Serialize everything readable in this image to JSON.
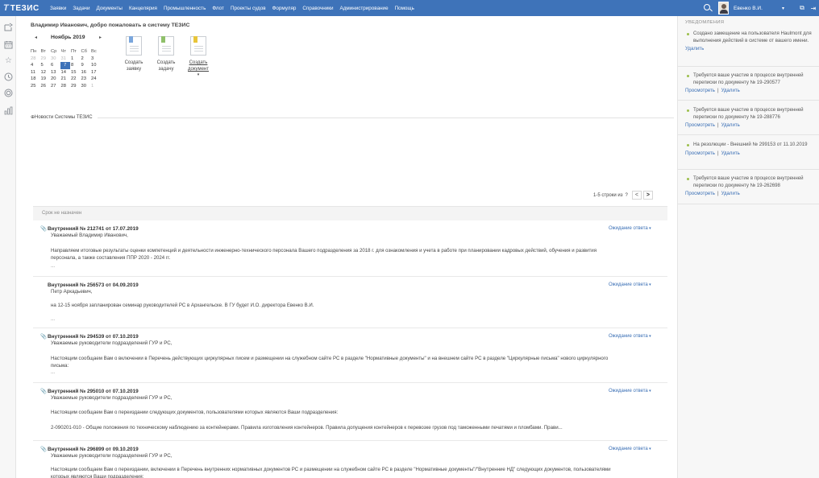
{
  "app": {
    "logo_mark": "Т",
    "logo_text": "ТЕЗИС"
  },
  "menu": [
    "Заявки",
    "Задачи",
    "Документы",
    "Канцелярия",
    "Промышленность",
    "Флот",
    "Проекты судов",
    "Формуляр",
    "Справочники",
    "Администрирование",
    "Помощь"
  ],
  "user": {
    "name": "Евенко В.И.",
    "caret": "▾"
  },
  "topbar_icons": {
    "search": "search-icon",
    "window": "window-icon",
    "exit": "exit-icon"
  },
  "welcome": "Владимир Иванович, добро пожаловать в систему ТЕЗИС",
  "calendar": {
    "prev": "◂",
    "next": "▸",
    "month": "Ноябрь 2019",
    "weekdays": [
      "Пн",
      "Вт",
      "Ср",
      "Чт",
      "Пт",
      "Сб",
      "Вс"
    ],
    "weeks": [
      [
        "28",
        "29",
        "30",
        "31",
        "1",
        "2",
        "3"
      ],
      [
        "4",
        "5",
        "6",
        "7",
        "8",
        "9",
        "10"
      ],
      [
        "11",
        "12",
        "13",
        "14",
        "15",
        "16",
        "17"
      ],
      [
        "18",
        "19",
        "20",
        "21",
        "22",
        "23",
        "24"
      ],
      [
        "25",
        "26",
        "27",
        "28",
        "29",
        "30",
        "1"
      ]
    ],
    "today": "7"
  },
  "actions": {
    "create_request": [
      "Создать",
      "заявку"
    ],
    "create_task": [
      "Создать",
      "задачу"
    ],
    "create_document": [
      "Создать",
      "документ"
    ],
    "dropdown_caret": "▾"
  },
  "news": {
    "title": "⊕Новости Системы ТЕЗИС"
  },
  "pager": {
    "text": "1-5 строки из",
    "total": "?",
    "prev": "<",
    "next": ">"
  },
  "group_label": "Срок не назначен",
  "items": [
    {
      "title": "Внутренний № 212741 от 17.07.2019",
      "greeting": "Уважаемый Владимир Иванович,",
      "body": "Направляем итоговые результаты оценки компетенций и деятельности инженерно-технического персонала Вашего подразделения за 2018 г. для ознакомления и учета в работе при планировании кадровых действий, обучения и развития персонала, а также составления ППР 2020 - 2024 гг.",
      "ellipsis": "...",
      "status": "Ожидание ответа"
    },
    {
      "title": "Внутренний № 256573 от 04.09.2019",
      "greeting": "Петр Аркадьевич,",
      "body": "на 12-15 ноября запланирован семинар руководителей РС в Архангельске. В ГУ будет И.О. директора Евенко В.И.",
      "ellipsis": "...",
      "status": "Ожидание ответа"
    },
    {
      "title": "Внутренний № 294539 от 07.10.2019",
      "greeting": "Уважаемые руководители подразделений ГУР и РС,",
      "body": "Настоящим сообщаем Вам о включении в Перечень действующих циркулярных писем и размещении на служебном сайте РС в разделе \"Нормативные документы\" и на внешнем сайте РС в разделе \"Циркулярные письма\" нового циркулярного письма:",
      "ellipsis": "...",
      "status": "Ожидание ответа"
    },
    {
      "title": "Внутренний № 295010 от 07.10.2019",
      "greeting": "Уважаемые руководители подразделений ГУР и РС,",
      "body": "Настоящим сообщаем Вам о переиздании следующих документов, пользователями которых являются Ваши подразделения:",
      "body2": "2-090201-010 - Общие положения по техническому наблюдению за контейнерами. Правила изготовления контейнеров. Правила допущения контейнеров к перевозке грузов под таможенными печатями и пломбами. Прави...",
      "status": "Ожидание ответа"
    },
    {
      "title": "Внутренний № 296899 от 09.10.2019",
      "greeting": "Уважаемые руководители подразделений ГУР и РС,",
      "body": "Настоящим сообщаем Вам о переиздании, включении в Перечень внутренних нормативных документов РС и размещении на служебном сайте РС в разделе \"Нормативные документы\"/\"Внутренние НД\" следующих документов, пользователями которых являются Ваши подразделения:",
      "status": "Ожидание ответа"
    }
  ],
  "notifications": {
    "title": "УВЕДОМЛЕНИЯ",
    "items": [
      {
        "text": "Создано замещение на пользователя Haulmont для выполнения действий в системе от вашего имени.",
        "view": "",
        "delete": "Удалить"
      },
      {
        "text": "Требуется ваше участие в процессе внутренней переписки по документу № 19-290577",
        "view": "Просмотреть",
        "delete": "Удалить"
      },
      {
        "text": "Требуется ваше участие в процессе внутренней переписки по документу № 19-288776",
        "view": "Просмотреть",
        "delete": "Удалить"
      },
      {
        "text": "На резолюции - Внешний № 299153 от 11.10.2019",
        "view": "Просмотреть",
        "delete": "Удалить"
      },
      {
        "text": "Требуется ваше участие в процессе внутренней переписки по документу № 19-262698",
        "view": "Просмотреть",
        "delete": "Удалить"
      }
    ],
    "separator": "|"
  },
  "colors": {
    "topbar": "#3e73b9",
    "link": "#3a6fb5",
    "today": "#3e73b9",
    "bullet": "#9bbf4a"
  },
  "left_rail_icons": [
    "inbox-arrow-icon",
    "calendar-icon",
    "star-icon",
    "clock-icon",
    "target-icon",
    "chart-icon"
  ]
}
